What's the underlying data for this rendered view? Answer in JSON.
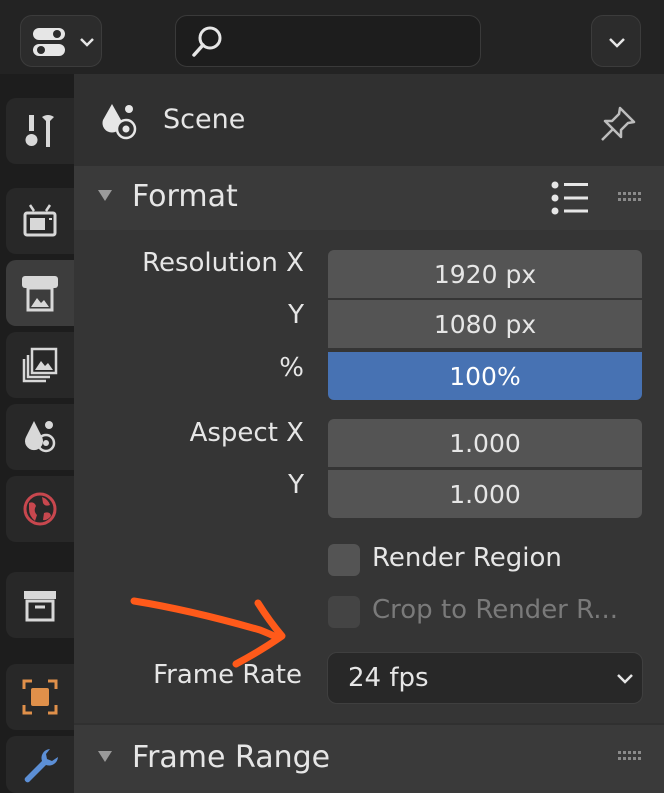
{
  "topbar": {
    "editor_type_icon": "properties-editor-icon",
    "search": {
      "value": "",
      "placeholder": ""
    },
    "options_icon": "chevron-down-icon"
  },
  "sidebar": {
    "tabs": [
      {
        "name": "tool",
        "icon": "tool-icon",
        "active": false
      },
      {
        "name": "render",
        "icon": "render-icon",
        "active": false
      },
      {
        "name": "output",
        "icon": "output-icon",
        "active": true
      },
      {
        "name": "view-layer",
        "icon": "view-layer-icon",
        "active": false
      },
      {
        "name": "scene",
        "icon": "scene-icon",
        "active": false
      },
      {
        "name": "world",
        "icon": "world-icon",
        "active": false
      },
      {
        "name": "collection",
        "icon": "collection-icon",
        "active": false
      },
      {
        "name": "object",
        "icon": "object-icon",
        "active": false
      },
      {
        "name": "modifiers",
        "icon": "wrench-icon",
        "active": false
      }
    ]
  },
  "header": {
    "context_label": "Scene",
    "pin_icon": "pin-icon"
  },
  "format": {
    "title": "Format",
    "resolution_x_label": "Resolution X",
    "resolution_x": "1920 px",
    "resolution_y_label": "Y",
    "resolution_y": "1080 px",
    "percent_label": "%",
    "percent": "100%",
    "aspect_x_label": "Aspect X",
    "aspect_x": "1.000",
    "aspect_y_label": "Y",
    "aspect_y": "1.000",
    "render_region_label": "Render Region",
    "render_region_checked": false,
    "crop_label": "Crop to Render R...",
    "crop_checked": false,
    "frame_rate_label": "Frame Rate",
    "frame_rate_value": "24 fps"
  },
  "frame_range": {
    "title": "Frame Range"
  },
  "colors": {
    "accent_blue": "#4772b3",
    "annotation_orange": "#ff5a1a",
    "panel_bg": "#303030",
    "section_bg": "#353535"
  }
}
